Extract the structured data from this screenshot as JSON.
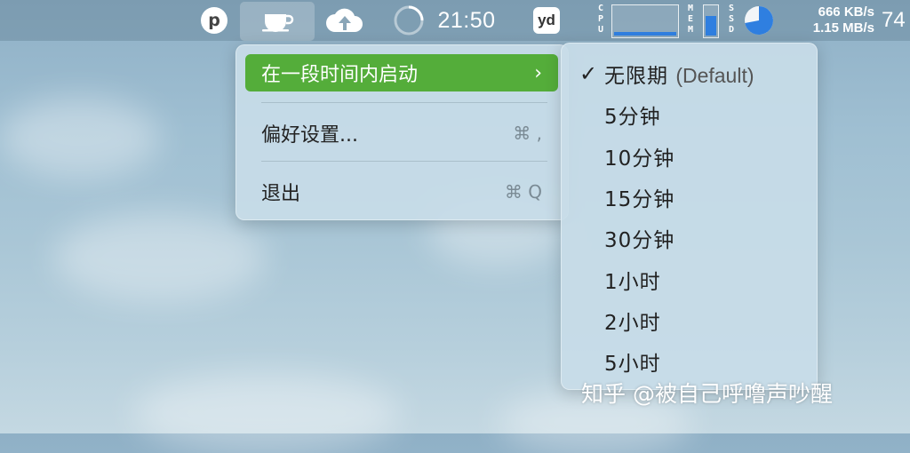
{
  "menubar": {
    "p_label": "p",
    "time": "21:50",
    "yd_label": "yd",
    "cpu_label": "CPU",
    "cpu_usage": 0.12,
    "mem_label": "MEM",
    "mem_usage": 0.7,
    "ssd_label": "SSD",
    "ssd_usage": 0.72,
    "net_up": "666 KB/s",
    "net_down": "1.15 MB/s",
    "trailing_number": "74",
    "icons": [
      "p-icon",
      "coffee-cup-icon",
      "cloud-upload-icon",
      "spinner-icon",
      "youdao-icon",
      "cpu-graph",
      "mem-graph",
      "ssd-pie"
    ]
  },
  "menu": {
    "items": [
      {
        "label": "在一段时间内启动",
        "submenu_arrow": "›"
      },
      {
        "label": "偏好设置...",
        "shortcut": "⌘ ,"
      },
      {
        "label": "退出",
        "shortcut": "⌘ Q"
      }
    ]
  },
  "submenu": {
    "check": "✓",
    "items": [
      {
        "label": "无限期",
        "suffix": "(Default)"
      },
      {
        "label": "5分钟"
      },
      {
        "label": "10分钟"
      },
      {
        "label": "15分钟"
      },
      {
        "label": "30分钟"
      },
      {
        "label": "1小时"
      },
      {
        "label": "2小时"
      },
      {
        "label": "5小时"
      }
    ]
  },
  "watermark": "知乎 @被自己呼噜声吵醒",
  "colors": {
    "highlight": "#54ad3a",
    "graph_fill": "#2f7fe0"
  }
}
